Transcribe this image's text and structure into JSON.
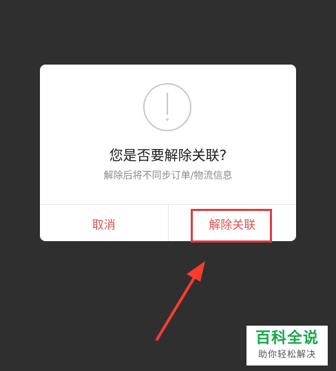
{
  "dialog": {
    "icon": "exclamation-circle-icon",
    "title": "您是否要解除关联?",
    "subtitle": "解除后将不同步订单/物流信息",
    "cancel_label": "取消",
    "confirm_label": "解除关联"
  },
  "watermark": {
    "title": "百科全说",
    "subtitle": "助你轻松解决"
  },
  "colors": {
    "background": "#2f2f2f",
    "dialog_background": "#ffffff",
    "action_text": "#d9534f",
    "highlight": "#e33b3b",
    "watermark_green": "#16a84a"
  }
}
